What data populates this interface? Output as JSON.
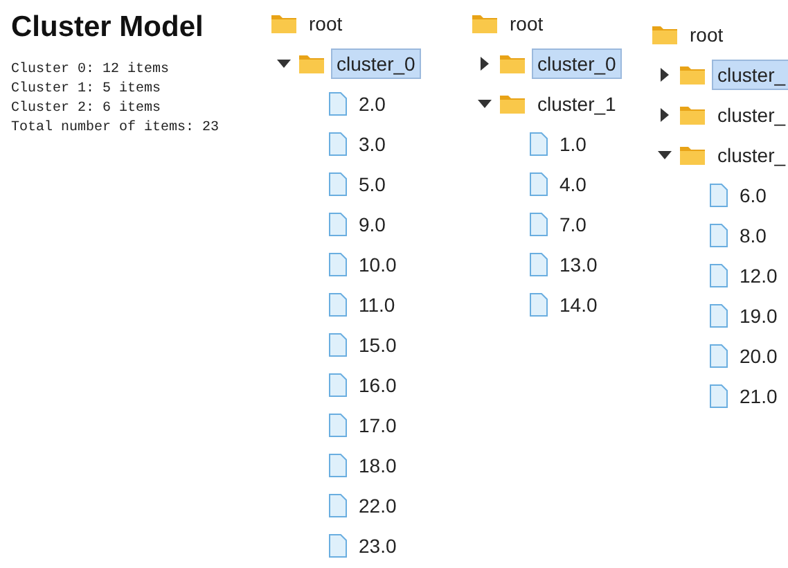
{
  "summary": {
    "title": "Cluster Model",
    "lines": [
      "Cluster 0: 12 items",
      "Cluster 1: 5 items",
      "Cluster 2: 6 items",
      "Total number of items: 23"
    ]
  },
  "trees": [
    {
      "root": {
        "kind": "folder",
        "label": "root",
        "selected": false,
        "children": [
          {
            "kind": "folder",
            "label": "cluster_0",
            "selected": true,
            "expanded": true,
            "children": [
              {
                "kind": "file",
                "label": "2.0",
                "selected": false
              },
              {
                "kind": "file",
                "label": "3.0",
                "selected": false
              },
              {
                "kind": "file",
                "label": "5.0",
                "selected": false
              },
              {
                "kind": "file",
                "label": "9.0",
                "selected": false
              },
              {
                "kind": "file",
                "label": "10.0",
                "selected": false
              },
              {
                "kind": "file",
                "label": "11.0",
                "selected": false
              },
              {
                "kind": "file",
                "label": "15.0",
                "selected": false
              },
              {
                "kind": "file",
                "label": "16.0",
                "selected": false
              },
              {
                "kind": "file",
                "label": "17.0",
                "selected": false
              },
              {
                "kind": "file",
                "label": "18.0",
                "selected": false
              },
              {
                "kind": "file",
                "label": "22.0",
                "selected": false
              },
              {
                "kind": "file",
                "label": "23.0",
                "selected": false
              }
            ]
          }
        ]
      }
    },
    {
      "root": {
        "kind": "folder",
        "label": "root",
        "selected": false,
        "children": [
          {
            "kind": "folder",
            "label": "cluster_0",
            "selected": true,
            "expanded": false
          },
          {
            "kind": "folder",
            "label": "cluster_1",
            "selected": false,
            "expanded": true,
            "children": [
              {
                "kind": "file",
                "label": "1.0",
                "selected": false
              },
              {
                "kind": "file",
                "label": "4.0",
                "selected": false
              },
              {
                "kind": "file",
                "label": "7.0",
                "selected": false
              },
              {
                "kind": "file",
                "label": "13.0",
                "selected": false
              },
              {
                "kind": "file",
                "label": "14.0",
                "selected": false
              }
            ]
          }
        ]
      }
    },
    {
      "root": {
        "kind": "folder",
        "label": "root",
        "selected": false,
        "children": [
          {
            "kind": "folder",
            "label": "cluster_",
            "selected": true,
            "expanded": false
          },
          {
            "kind": "folder",
            "label": "cluster_",
            "selected": false,
            "expanded": false
          },
          {
            "kind": "folder",
            "label": "cluster_",
            "selected": false,
            "expanded": true,
            "children": [
              {
                "kind": "file",
                "label": "6.0",
                "selected": false
              },
              {
                "kind": "file",
                "label": "8.0",
                "selected": false
              },
              {
                "kind": "file",
                "label": "12.0",
                "selected": false
              },
              {
                "kind": "file",
                "label": "19.0",
                "selected": false
              },
              {
                "kind": "file",
                "label": "20.0",
                "selected": false
              },
              {
                "kind": "file",
                "label": "21.0",
                "selected": false
              }
            ]
          }
        ]
      }
    }
  ]
}
